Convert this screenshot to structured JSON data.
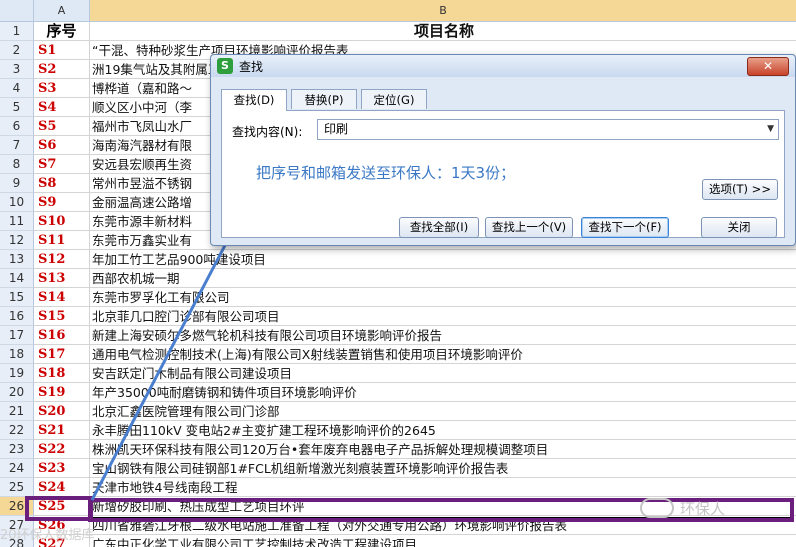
{
  "sheet": {
    "col_a": "A",
    "col_b": "B",
    "header": {
      "num": "1",
      "a": "序号",
      "b": "项目名称"
    },
    "rows": [
      {
        "num": "2",
        "a": "S1",
        "b": "“干混、特种砂浆生产项目环境影响评价报告表"
      },
      {
        "num": "3",
        "a": "S2",
        "b": "洲19集气站及其附属工程"
      },
      {
        "num": "4",
        "a": "S3",
        "b": "博桦道（嘉和路～"
      },
      {
        "num": "5",
        "a": "S4",
        "b": "顺义区小中河（李"
      },
      {
        "num": "6",
        "a": "S5",
        "b": "福州市飞凤山水厂"
      },
      {
        "num": "7",
        "a": "S6",
        "b": "海南海汽器材有限"
      },
      {
        "num": "8",
        "a": "S7",
        "b": "安远县宏顺再生资"
      },
      {
        "num": "9",
        "a": "S8",
        "b": "常州市昱溢不锈钢"
      },
      {
        "num": "10",
        "a": "S9",
        "b": "金丽温高速公路增"
      },
      {
        "num": "11",
        "a": "S10",
        "b": "东莞市源丰新材料"
      },
      {
        "num": "12",
        "a": "S11",
        "b": "东莞市万鑫实业有"
      },
      {
        "num": "13",
        "a": "S12",
        "b": "年加工竹工艺品900吨建设项目"
      },
      {
        "num": "14",
        "a": "S13",
        "b": "西部农机城一期"
      },
      {
        "num": "15",
        "a": "S14",
        "b": "东莞市罗孚化工有限公司"
      },
      {
        "num": "16",
        "a": "S15",
        "b": "北京菲几口腔门诊部有限公司项目"
      },
      {
        "num": "17",
        "a": "S16",
        "b": "新建上海安硕尔多燃气轮机科技有限公司项目环境影响评价报告"
      },
      {
        "num": "18",
        "a": "S17",
        "b": "通用电气检测控制技术(上海)有限公司X射线装置销售和使用项目环境影响评价"
      },
      {
        "num": "19",
        "a": "S18",
        "b": "安吉跃定门木制品有限公司建设项目"
      },
      {
        "num": "20",
        "a": "S19",
        "b": "年产35000吨耐磨铸钢和铸件项目环境影响评价"
      },
      {
        "num": "21",
        "a": "S20",
        "b": "北京汇鑫医院管理有限公司门诊部"
      },
      {
        "num": "22",
        "a": "S21",
        "b": "永丰腾田110kV 变电站2#主变扩建工程环境影响评价的2645"
      },
      {
        "num": "23",
        "a": "S22",
        "b": "株洲凯天环保科技有限公司120万台•套年废弃电器电子产品拆解处理规模调整项目"
      },
      {
        "num": "24",
        "a": "S23",
        "b": "宝山钢铁有限公司硅钢部1#FCL机组新增激光刻痕装置环境影响评价报告表"
      },
      {
        "num": "25",
        "a": "S24",
        "b": "天津市地铁4号线南段工程"
      },
      {
        "num": "26",
        "a": "S25",
        "b": "新增矽胶印刷、热压成型工艺项目环评"
      },
      {
        "num": "27",
        "a": "S26",
        "b": "四川省雅砻江牙根二级水电站施工准备工程（对外交通专用公路）环境影响评价报告表"
      },
      {
        "num": "28",
        "a": "S27",
        "b": "广东中正化学工业有限公司工艺控制技术改造工程建设项目"
      }
    ]
  },
  "dialog": {
    "icon_letter": "S",
    "title": "查找",
    "close_label": "✕",
    "tabs": [
      "查找(D)",
      "替换(P)",
      "定位(G)"
    ],
    "find_label": "查找内容(N):",
    "find_value": "印刷",
    "note": "把序号和邮箱发送至环保人：1天3份；",
    "options_button": "选项(T) >>",
    "find_all_button": "查找全部(I)",
    "find_prev_button": "查找上一个(V)",
    "find_next_button": "查找下一个(F)",
    "close_button": "关闭"
  },
  "watermark": {
    "left": "20环保人数据库",
    "right": "环保人"
  },
  "colors": {
    "accent_red": "#cc0000",
    "highlight_purple": "#6a1f7c",
    "note_blue": "#3a78c5"
  }
}
